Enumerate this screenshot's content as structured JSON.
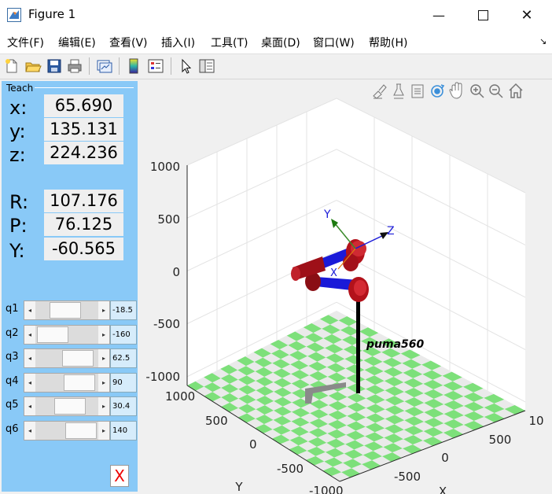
{
  "window": {
    "title": "Figure 1",
    "minimize": "—",
    "maximize": "☐",
    "close": "✕"
  },
  "menu": [
    "文件(F)",
    "编辑(E)",
    "查看(V)",
    "插入(I)",
    "工具(T)",
    "桌面(D)",
    "窗口(W)",
    "帮助(H)"
  ],
  "menu_corner": "↘",
  "toolbar_icons": [
    "new-figure-icon",
    "open-file-icon",
    "save-icon",
    "print-icon",
    "link-plot-icon",
    "insert-colorbar-icon",
    "insert-legend-icon",
    "edit-plot-arrow-icon",
    "property-inspector-icon"
  ],
  "teach": {
    "label": "Teach",
    "pose": [
      {
        "label": "x:",
        "value": "65.690"
      },
      {
        "label": "y:",
        "value": "135.131"
      },
      {
        "label": "z:",
        "value": "224.236"
      },
      {
        "label": "R:",
        "value": "107.176"
      },
      {
        "label": "P:",
        "value": "76.125"
      },
      {
        "label": "Y:",
        "value": "-60.565"
      }
    ],
    "joints": [
      {
        "label": "q1",
        "value": "-18.5",
        "pos": 0.45
      },
      {
        "label": "q2",
        "value": "-160",
        "pos": 0.05
      },
      {
        "label": "q3",
        "value": "62.5",
        "pos": 0.85
      },
      {
        "label": "q4",
        "value": "90",
        "pos": 0.9
      },
      {
        "label": "q5",
        "value": "30.4",
        "pos": 0.6
      },
      {
        "label": "q6",
        "value": "140",
        "pos": 0.95
      }
    ],
    "close_label": "X"
  },
  "axes_toolbar": [
    "brush-icon",
    "data-tips-icon",
    "restore-view-icon",
    "rotate-3d-icon",
    "pan-icon",
    "zoom-in-icon",
    "zoom-out-icon",
    "home-icon"
  ],
  "plot": {
    "z_ticks": [
      "1000",
      "500",
      "0",
      "-500",
      "-1000"
    ],
    "y_ticks": [
      "1000",
      "500",
      "0",
      "-500",
      "-1000"
    ],
    "x_ticks": [
      "-500",
      "0",
      "500",
      "10"
    ],
    "y_axis_label": "Y",
    "x_axis_label": "X",
    "robot_name": "puma560",
    "frame_labels": {
      "x": "X",
      "y": "Y",
      "z": "Z"
    },
    "floor_colors": {
      "green": "#7de07a",
      "white": "#eaeaea"
    },
    "link_colors": {
      "red": "#b3121b",
      "blue": "#1a1ad8"
    }
  }
}
